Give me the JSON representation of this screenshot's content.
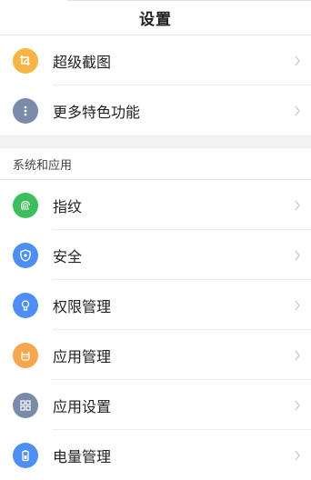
{
  "header": {
    "title": "设置"
  },
  "group1": [
    {
      "label": "超级截图",
      "icon": "crop-icon",
      "color": "#F6B544"
    },
    {
      "label": "更多特色功能",
      "icon": "more-icon",
      "color": "#7A8BAA"
    }
  ],
  "section": {
    "title": "系统和应用"
  },
  "group2": [
    {
      "label": "指纹",
      "icon": "fingerprint-icon",
      "color": "#3DBE5C"
    },
    {
      "label": "安全",
      "icon": "shield-icon",
      "color": "#4D8FF5"
    },
    {
      "label": "权限管理",
      "icon": "permission-icon",
      "color": "#4D8FF5"
    },
    {
      "label": "应用管理",
      "icon": "app-manage-icon",
      "color": "#F6A64D"
    },
    {
      "label": "应用设置",
      "icon": "grid-icon",
      "color": "#7A8BAA"
    },
    {
      "label": "电量管理",
      "icon": "battery-icon",
      "color": "#4D8FF5"
    }
  ]
}
